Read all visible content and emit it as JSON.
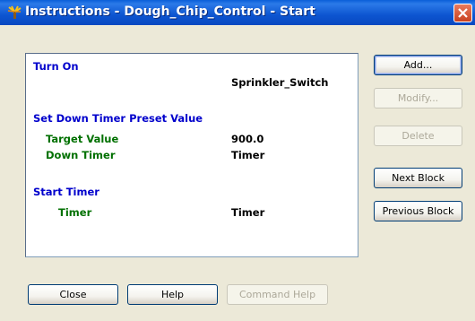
{
  "window": {
    "title": "Instructions - Dough_Chip_Control - Start"
  },
  "icons": {
    "app": "sprinkler-app-icon",
    "close": "close-icon"
  },
  "instructions": {
    "turn_on": {
      "heading": "Turn On",
      "value": "Sprinkler_Switch"
    },
    "set_timer": {
      "heading": "Set Down Timer Preset Value",
      "target_label": "Target Value",
      "target_value": "900.0",
      "timer_label": "Down Timer",
      "timer_value": "Timer"
    },
    "start_timer": {
      "heading": "Start Timer",
      "timer_label": "Timer",
      "timer_value": "Timer"
    }
  },
  "buttons": {
    "add": "Add...",
    "modify": "Modify...",
    "delete": "Delete",
    "next_block": "Next Block",
    "previous_block": "Previous Block",
    "close": "Close",
    "help": "Help",
    "command_help": "Command Help"
  },
  "colors": {
    "heading": "#0000cc",
    "label": "#007000",
    "titlebar": "#0a5fd8"
  }
}
